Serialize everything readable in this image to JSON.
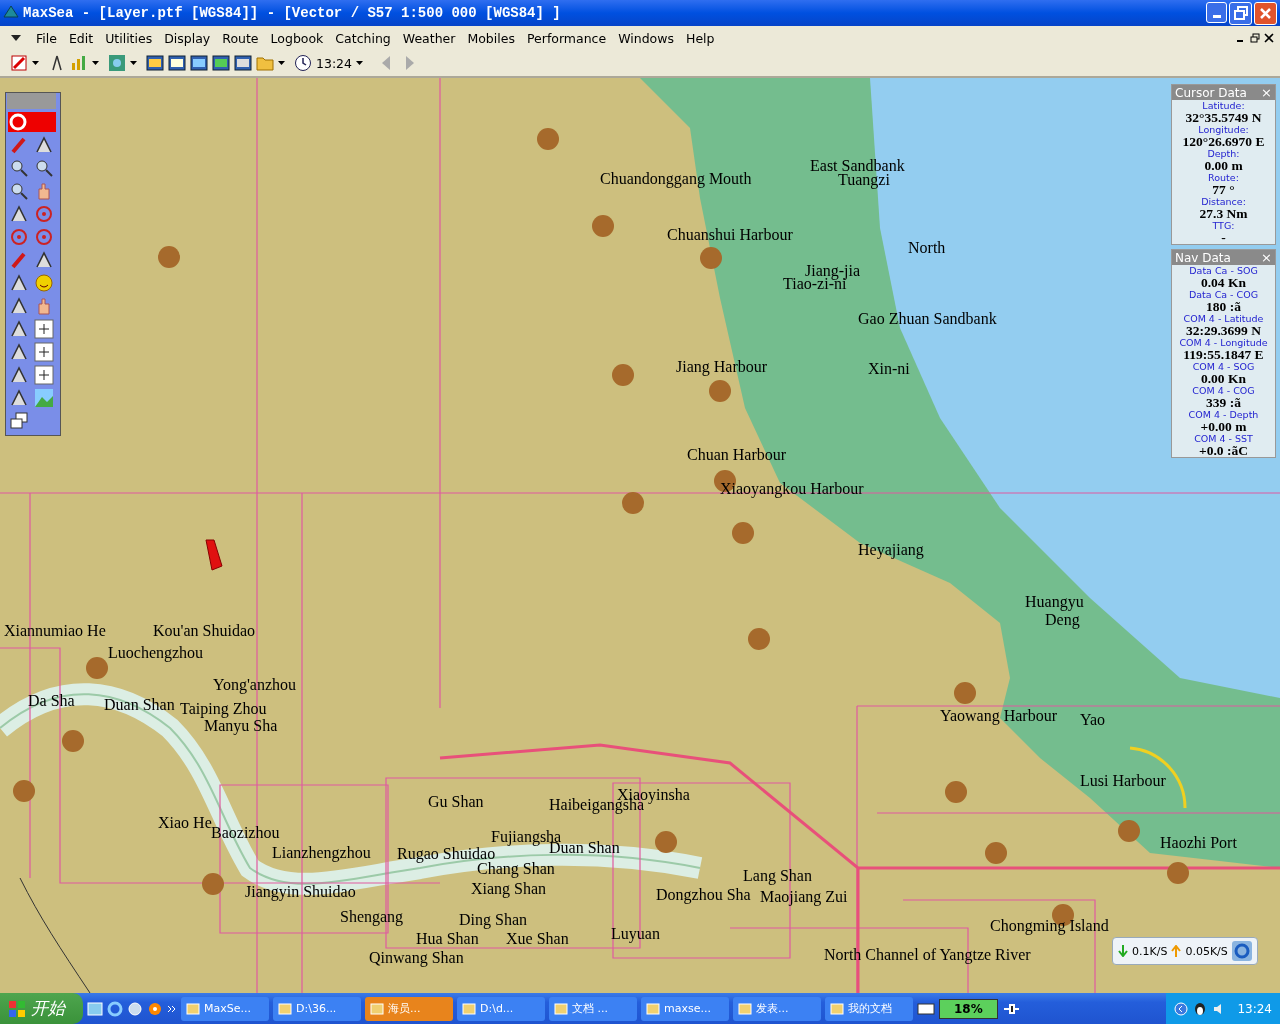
{
  "window": {
    "title": "MaxSea - [Layer.ptf [WGS84]] - [Vector / S57  1:500 000 [WGS84] ]"
  },
  "menu": [
    "File",
    "Edit",
    "Utilities",
    "Display",
    "Route",
    "Logbook",
    "Catching",
    "Weather",
    "Mobiles",
    "Performance",
    "Windows",
    "Help"
  ],
  "toolbar": {
    "clock": "13:24"
  },
  "chart": {
    "labels": [
      "East Sandbank",
      "Chuandonggang Mouth",
      "Tuangzi",
      "Chuanshui Harbour",
      "North",
      "Jiang-jia",
      "Tiao-zi-ni",
      "Gao Zhuan Sandbank",
      "Jiang Harbour",
      "Xin-ni",
      "Chuan Harbour",
      "Xiaoyangkou Harbour",
      "Heyajiang",
      "Huangyu",
      "Deng",
      "Xiannumiao He",
      "Kou'an Shuidao",
      "Luochengzhou",
      "Yong'anzhou",
      "Da Sha",
      "Duan Shan",
      "Taiping Zhou",
      "Yaowang Harbour",
      "Yao",
      "Manyu Sha",
      "Lusi Harbour",
      "Xiaoyinsha",
      "Gu Shan",
      "Haibeigangsha",
      "Xiao He",
      "Baozizhou",
      "Fujiangsha",
      "Haozhi Port",
      "Duan Shan",
      "Lianzhengzhou",
      "Rugao Shuidao",
      "Chang Shan",
      "Lang Shan",
      "Jiangyin Shuidao",
      "Xiang Shan",
      "Dongzhou Sha",
      "Maojiang Zui",
      "Shengang",
      "Ding Shan",
      "Chongming Island",
      "Hua Shan",
      "Xue Shan",
      "Luyuan",
      "Qinwang Shan",
      "North Channel of Yangtze River"
    ]
  },
  "cursor_data": {
    "title": "Cursor Data",
    "close": "×",
    "fields": [
      {
        "label": "Latitude:",
        "value": "32°35.5749 N"
      },
      {
        "label": "Longitude:",
        "value": "120°26.6970 E"
      },
      {
        "label": "Depth:",
        "value": "0.00 m"
      },
      {
        "label": "Route:",
        "value": "77 °"
      },
      {
        "label": "Distance:",
        "value": "27.3 Nm"
      },
      {
        "label": "TTG:",
        "value": "-"
      }
    ]
  },
  "nav_data": {
    "title": "Nav Data",
    "close": "×",
    "fields": [
      {
        "label": "Data Ca - SOG",
        "value": "0.04 Kn"
      },
      {
        "label": "Data Ca - COG",
        "value": "180 :ã"
      },
      {
        "label": "COM 4 - Latitude",
        "value": "32:29.3699 N"
      },
      {
        "label": "COM 4 - Longitude",
        "value": "119:55.1847 E"
      },
      {
        "label": "COM 4 - SOG",
        "value": "0.00 Kn"
      },
      {
        "label": "COM 4 - COG",
        "value": "339 :ã"
      },
      {
        "label": "COM 4 - Depth",
        "value": "+0.00 m"
      },
      {
        "label": "COM 4 - SST",
        "value": "+0.0 :ãC"
      }
    ]
  },
  "network_popup": {
    "down": "0.1K/S",
    "up": "0.05K/S"
  },
  "taskbar": {
    "start": "开始",
    "items": [
      {
        "label": "MaxSe...",
        "selected": false
      },
      {
        "label": "D:\\36...",
        "selected": false
      },
      {
        "label": "海员...",
        "selected": true
      },
      {
        "label": "D:\\d...",
        "selected": false
      },
      {
        "label": "文档 ...",
        "selected": false
      },
      {
        "label": "maxse...",
        "selected": false
      },
      {
        "label": "发表...",
        "selected": false
      },
      {
        "label": "我的文档",
        "selected": false
      }
    ],
    "battery": "18%",
    "clock": "13:24"
  }
}
